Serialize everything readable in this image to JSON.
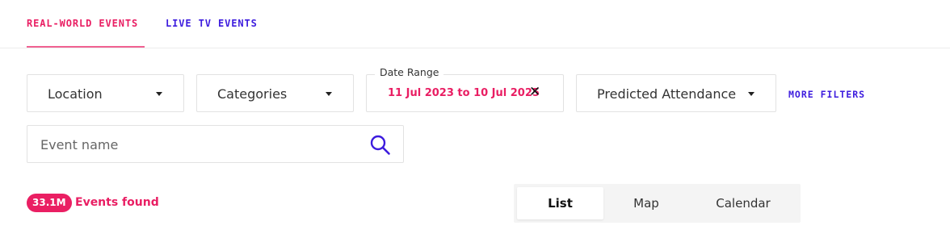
{
  "tabs": [
    {
      "label": "REAL-WORLD EVENTS",
      "active": true
    },
    {
      "label": "LIVE TV EVENTS",
      "active": false
    }
  ],
  "filters": {
    "location": "Location",
    "categories": "Categories",
    "date_range": {
      "legend": "Date Range",
      "value": "11 Jul 2023 to 10 Jul 2025",
      "clear_glyph": "✕"
    },
    "predicted_attendance": "Predicted Attendance",
    "more_filters": "MORE FILTERS"
  },
  "search": {
    "placeholder": "Event name",
    "value": "",
    "icon": "search-icon"
  },
  "results": {
    "count": "33.1M",
    "label": "Events found"
  },
  "views": {
    "list": "List",
    "map": "Map",
    "calendar": "Calendar",
    "selected": "List"
  },
  "colors": {
    "accent_pink": "#e91e63",
    "accent_purple": "#3d1cde"
  }
}
